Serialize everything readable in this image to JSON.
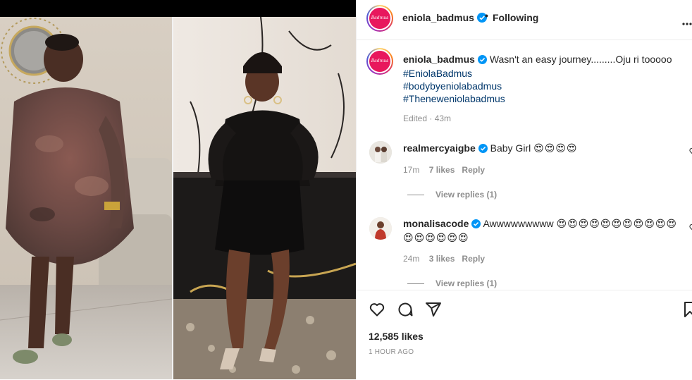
{
  "post": {
    "username": "eniola_badmus",
    "follow_separator": "•",
    "follow_label": "Following",
    "caption_text": "Wasn't an easy journey.........Oju ri tooooo",
    "hashtags": [
      "#EniolaBadmus",
      "#bodybyeniolabadmus",
      "#Theneweniolabadmus"
    ],
    "edited_meta": "Edited · 43m",
    "avatar_text": "Badmus",
    "likes": "12,585 likes",
    "time_ago": "1 HOUR AGO"
  },
  "comments": [
    {
      "username": "realmercyaigbe",
      "text": "Baby Girl",
      "emojis": "😍😍😍😍",
      "time": "17m",
      "likes": "7 likes",
      "reply_label": "Reply",
      "view_replies": "View replies (1)"
    },
    {
      "username": "monalisacode",
      "text": "Awwwwwwwww",
      "emojis": "😍😍😍😍😍😍😍😍😍😍😍😍😍😍😍😍😍",
      "time": "24m",
      "likes": "3 likes",
      "reply_label": "Reply",
      "view_replies": "View replies (1)"
    }
  ],
  "icons": {
    "more": "more-options-icon",
    "verified": "verified-badge-icon",
    "like": "heart-icon",
    "comment": "comment-icon",
    "share": "share-icon",
    "save": "bookmark-icon"
  },
  "colors": {
    "verified_blue": "#0095f6",
    "hashtag_blue": "#00376b",
    "muted": "#8e8e8e",
    "avatar_pink": "#e8175d"
  }
}
